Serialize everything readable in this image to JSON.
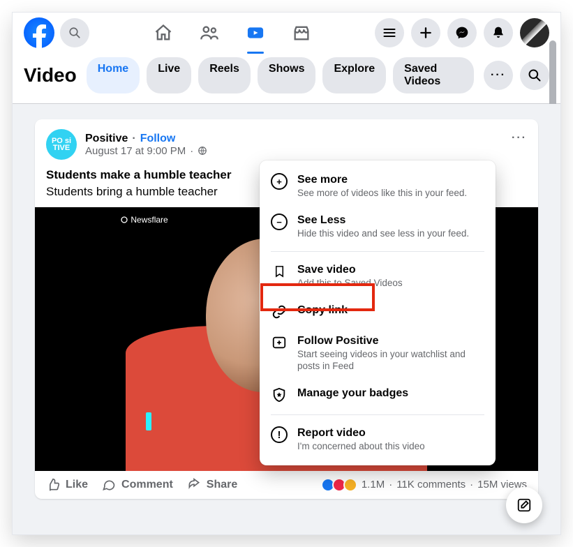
{
  "top_nav": {
    "tabs": [
      "home",
      "friends",
      "video",
      "marketplace"
    ]
  },
  "secondary": {
    "title": "Video",
    "chips": [
      {
        "label": "Home",
        "active": true
      },
      {
        "label": "Live"
      },
      {
        "label": "Reels"
      },
      {
        "label": "Shows"
      },
      {
        "label": "Explore"
      },
      {
        "label": "Saved Videos"
      }
    ]
  },
  "post": {
    "page_name": "Positive",
    "page_avatar_lines": [
      "PO si",
      "TIVE"
    ],
    "follow_label": "Follow",
    "separator": "·",
    "timestamp": "August 17 at 9:00 PM",
    "privacy_icon": "globe",
    "text_line1": "Students make a humble teacher",
    "text_line2": "Students bring a humble teacher",
    "watermark": "Newsflare",
    "actions": {
      "like": "Like",
      "comment": "Comment",
      "share": "Share"
    },
    "stats": {
      "reactions": "1.1M",
      "comments": "11K comments",
      "views": "15M views"
    }
  },
  "popover": {
    "items": [
      {
        "title": "See more",
        "sub": "See more of videos like this in your feed.",
        "icon": "plus"
      },
      {
        "title": "See Less",
        "sub": "Hide this video and see less in your feed.",
        "icon": "minus"
      },
      {
        "div": true
      },
      {
        "title": "Save video",
        "sub": "Add this to Saved Videos",
        "icon": "bookmark"
      },
      {
        "title": "Copy link",
        "icon": "link",
        "highlighted": true
      },
      {
        "title": "Follow Positive",
        "sub": "Start seeing videos in your watchlist and posts in Feed",
        "icon": "follow"
      },
      {
        "title": "Manage your badges",
        "icon": "badge"
      },
      {
        "div": true
      },
      {
        "title": "Report video",
        "sub": "I'm concerned about this video",
        "icon": "report"
      }
    ]
  }
}
